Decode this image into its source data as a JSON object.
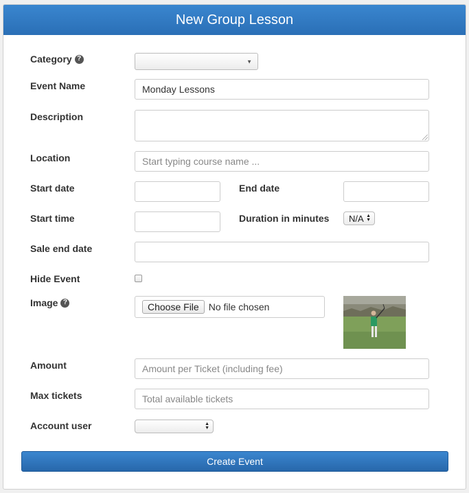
{
  "header": {
    "title": "New Group Lesson"
  },
  "labels": {
    "category": "Category",
    "event_name": "Event Name",
    "description": "Description",
    "location": "Location",
    "start_date": "Start date",
    "end_date": "End date",
    "start_time": "Start time",
    "duration": "Duration in minutes",
    "sale_end_date": "Sale end date",
    "hide_event": "Hide Event",
    "image": "Image",
    "amount": "Amount",
    "max_tickets": "Max tickets",
    "account_user": "Account user"
  },
  "fields": {
    "category_value": "",
    "event_name_value": "Monday Lessons",
    "location_placeholder": "Start typing course name ...",
    "duration_value": "N/A",
    "amount_placeholder": "Amount per Ticket (including fee)",
    "max_tickets_placeholder": "Total available tickets",
    "account_user_value": "",
    "hide_event_checked": false
  },
  "file": {
    "button": "Choose File",
    "status": "No file chosen"
  },
  "actions": {
    "submit": "Create Event"
  },
  "colors": {
    "header": "#2f78c2",
    "button": "#2d6fb4"
  },
  "icons": {
    "help": "question-circle-icon"
  }
}
